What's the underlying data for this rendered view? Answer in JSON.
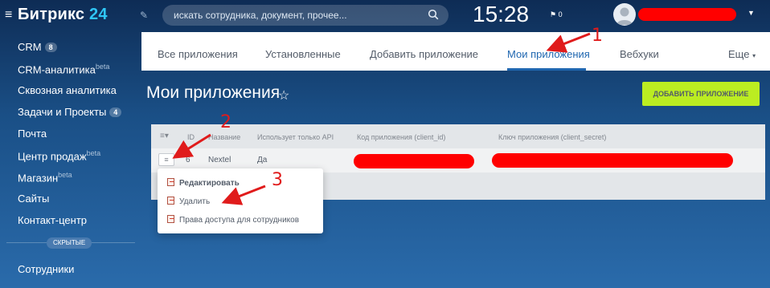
{
  "header": {
    "brand": "Битрикс",
    "brand_number": "24",
    "search_placeholder": "искать сотрудника, документ, прочее...",
    "time": "15:28",
    "notifications_count": "0",
    "redacted_color": "#ff0000"
  },
  "sidebar": {
    "items": [
      {
        "label": "CRM",
        "badge": "8"
      },
      {
        "label": "CRM-аналитика",
        "sup": "beta"
      },
      {
        "label": "Сквозная аналитика"
      },
      {
        "label": "Задачи и Проекты",
        "badge": "4"
      },
      {
        "label": "Почта"
      },
      {
        "label": "Центр продаж",
        "sup": "beta"
      },
      {
        "label": "Магазин",
        "sup": "beta"
      },
      {
        "label": "Сайты"
      },
      {
        "label": "Контакт-центр"
      }
    ],
    "hidden_label": "СКРЫТЫЕ",
    "after_hidden": [
      {
        "label": "Сотрудники"
      }
    ]
  },
  "tabs": [
    {
      "label": "Все приложения",
      "active": false
    },
    {
      "label": "Установленные",
      "active": false
    },
    {
      "label": "Добавить приложение",
      "active": false
    },
    {
      "label": "Мои приложения",
      "active": true
    },
    {
      "label": "Вебхуки",
      "active": false
    },
    {
      "label": "Еще",
      "active": false
    }
  ],
  "page": {
    "title": "Мои приложения",
    "add_button": "ДОБАВИТЬ ПРИЛОЖЕНИЕ",
    "accent": "#bbed21"
  },
  "grid": {
    "columns": [
      "ID",
      "Название",
      "Использует только API",
      "Код приложения (client_id)",
      "Ключ приложения (client_secret)"
    ],
    "rows": [
      {
        "id": "6",
        "name": "Nextel",
        "api_only": "Да"
      }
    ]
  },
  "context_menu": {
    "items": [
      "Редактировать",
      "Удалить",
      "Права доступа для сотрудников"
    ]
  },
  "annotations": [
    "1",
    "2",
    "3"
  ]
}
